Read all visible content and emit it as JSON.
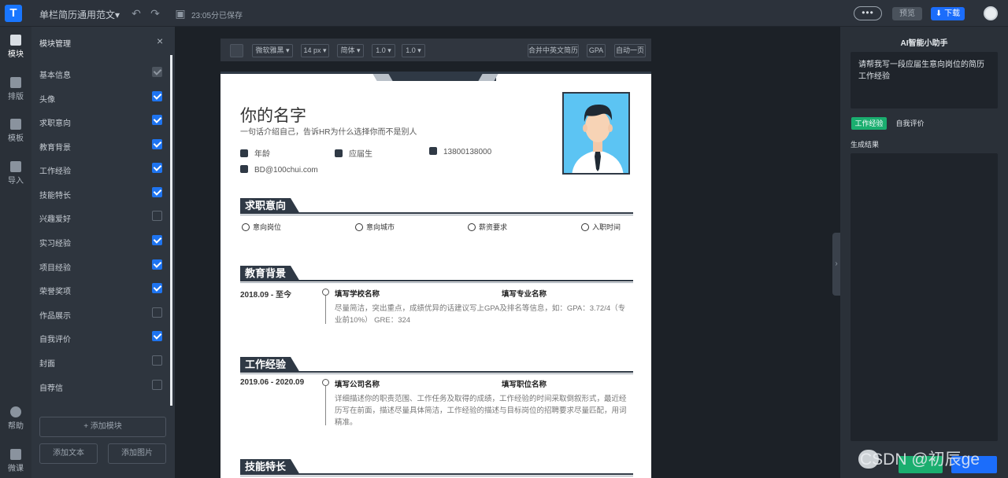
{
  "topbar": {
    "doc_title": "单栏简历通用范文▾",
    "save_status": "23:05分已保存",
    "more": "•••",
    "preview": "预览",
    "download": "下载"
  },
  "iconbar": {
    "items": [
      {
        "label": "模块",
        "icon": "modules-icon"
      },
      {
        "label": "排版",
        "icon": "shirt-icon"
      },
      {
        "label": "模板",
        "icon": "layers-icon"
      },
      {
        "label": "导入",
        "icon": "cloud-upload-icon"
      },
      {
        "label": "帮助",
        "icon": "help-icon"
      },
      {
        "label": "微课",
        "icon": "play-icon"
      }
    ]
  },
  "module_panel": {
    "title": "模块管理",
    "close": "×",
    "modules": [
      {
        "label": "基本信息",
        "state": "disabled"
      },
      {
        "label": "头像",
        "state": "on"
      },
      {
        "label": "求职意向",
        "state": "on"
      },
      {
        "label": "教育背景",
        "state": "on"
      },
      {
        "label": "工作经验",
        "state": "on"
      },
      {
        "label": "技能特长",
        "state": "on"
      },
      {
        "label": "兴趣爱好",
        "state": "off"
      },
      {
        "label": "实习经验",
        "state": "on"
      },
      {
        "label": "项目经验",
        "state": "on"
      },
      {
        "label": "荣誉奖项",
        "state": "on"
      },
      {
        "label": "作品展示",
        "state": "off"
      },
      {
        "label": "自我评价",
        "state": "on"
      },
      {
        "label": "封面",
        "state": "off"
      },
      {
        "label": "自荐信",
        "state": "off"
      }
    ],
    "add_module": "+ 添加模块",
    "add_text": "添加文本",
    "add_image": "添加图片"
  },
  "format_bar": {
    "font": "微软雅黑 ▾",
    "size": "14 px ▾",
    "script": "简体 ▾",
    "line_height": "1.0 ▾",
    "spacing": "1.0 ▾",
    "merge": "合并中英文简历",
    "gpa": "GPA",
    "one_page": "自动一页"
  },
  "resume": {
    "name": "你的名字",
    "tagline": "一句话介绍自己，告诉HR为什么选择你而不是别人",
    "age": "年龄",
    "status": "应届生",
    "phone": "13800138000",
    "email": "BD@100chui.com",
    "intent": {
      "title": "求职意向",
      "position": "意向岗位",
      "city": "意向城市",
      "salary": "薪资要求",
      "start": "入职时间"
    },
    "education": {
      "title": "教育背景",
      "date": "2018.09 - 至今",
      "school": "填写学校名称",
      "major": "填写专业名称",
      "desc": "尽量简洁，突出重点，成绩优异的话建议写上GPA及排名等信息，如：GPA：3.72/4（专业前10%） GRE：324"
    },
    "work": {
      "title": "工作经验",
      "date": "2019.06 - 2020.09",
      "company": "填写公司名称",
      "role": "填写职位名称",
      "desc": "详细描述你的职责范围、工作任务及取得的成绩，工作经验的时间采取倒叙形式，最近经历写在前面，描述尽量具体简洁，工作经验的描述与目标岗位的招聘要求尽量匹配，用词精准。"
    },
    "skills": {
      "title": "技能特长"
    }
  },
  "ai_panel": {
    "title": "AI智能小助手",
    "prompt": "请帮我写一段应届生意向岗位的简历工作经验",
    "tab_work": "工作经验",
    "tab_self": "自我评价",
    "result_label": "生成结果",
    "watermark": "CSDN @初辰ge"
  },
  "colors": {
    "accent": "#1b6dfb",
    "green": "#1aae6f",
    "resume_dark": "#2f3945",
    "photo_bg": "#5cc4f3"
  }
}
